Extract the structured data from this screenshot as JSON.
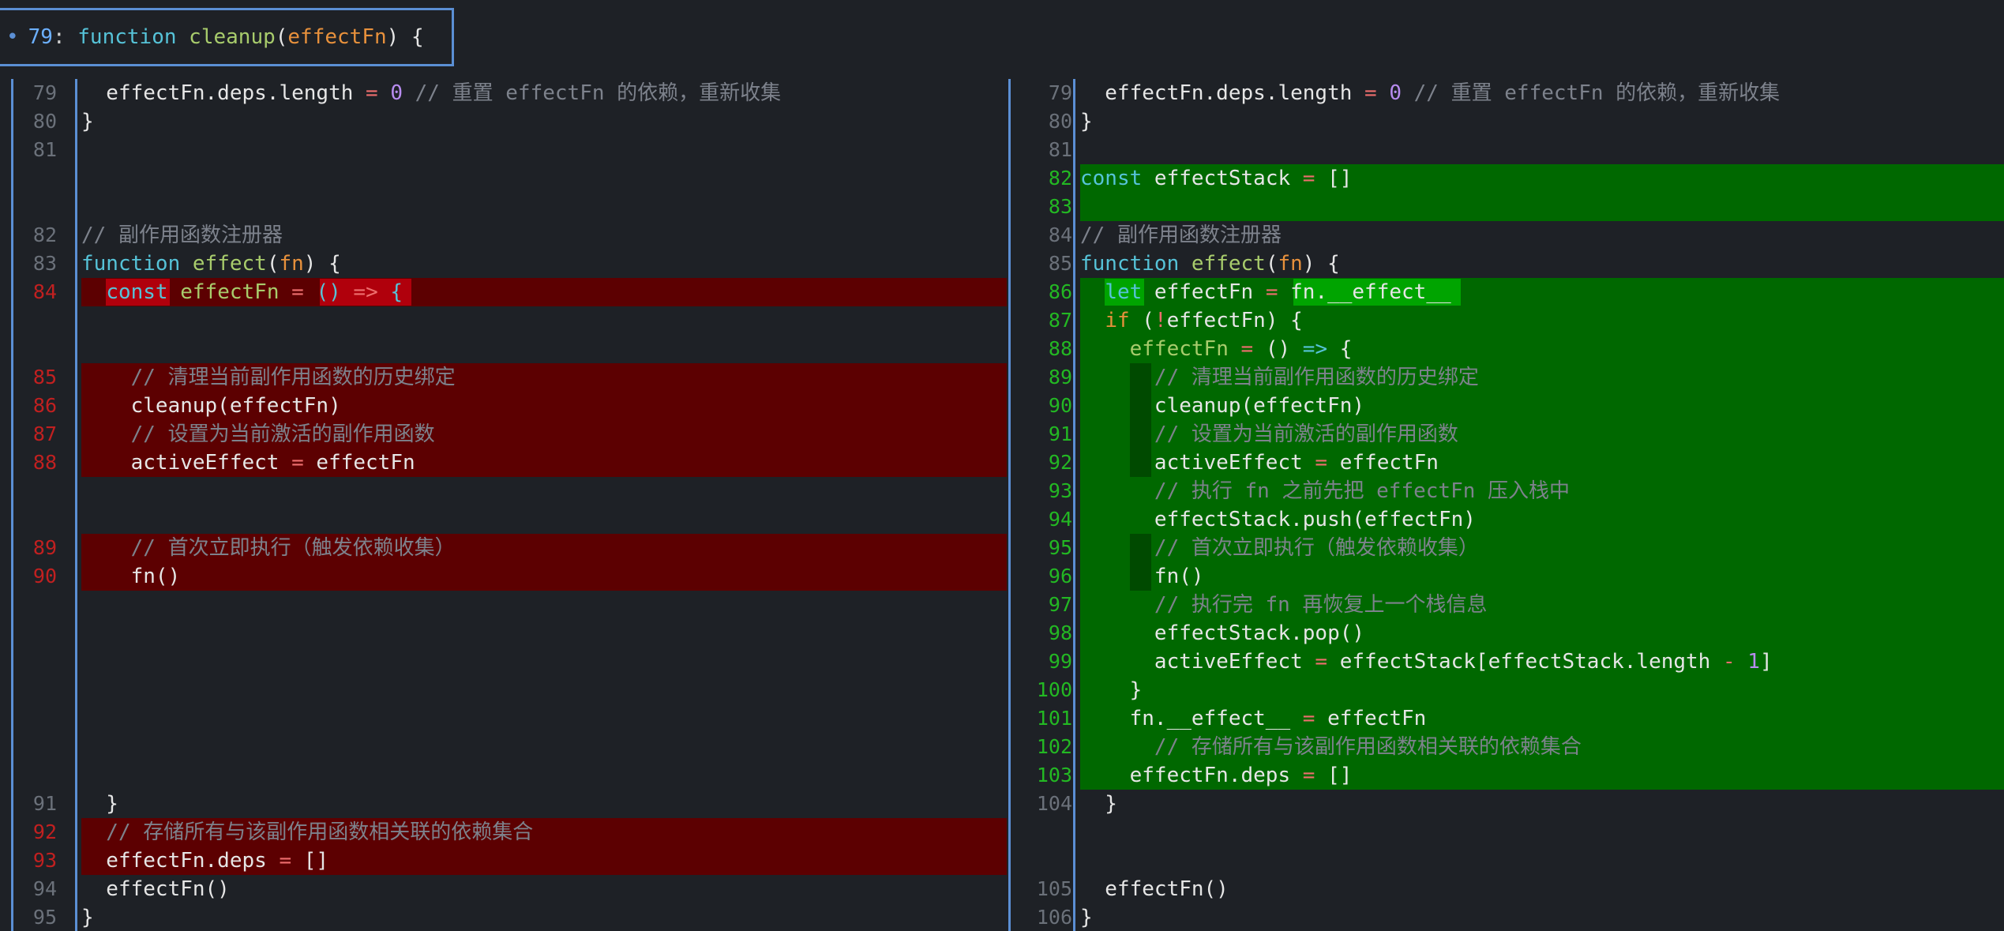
{
  "header": {
    "dot": "•",
    "line_number": "79",
    "colon": ":",
    "keyword": "function",
    "function_name": "cleanup",
    "open_paren": "(",
    "param": "effectFn",
    "close": ") {"
  },
  "left_pane": {
    "line_numbers": {
      "l79": "79",
      "l80": "80",
      "l81": "81",
      "l82": "82",
      "l83": "83",
      "l84": "84",
      "l85": "85",
      "l86": "86",
      "l87": "87",
      "l88": "88",
      "l89": "89",
      "l90": "90",
      "l91": "91",
      "l92": "92",
      "l93": "93",
      "l94": "94",
      "l95": "95"
    },
    "code": {
      "l79": "  effectFn.deps.length = 0 // 重置 effectFn 的依赖，重新收集",
      "l80": "}",
      "l82": "// 副作用函数注册器",
      "l83": "function effect(fn) {",
      "l84": "  const effectFn = () => {",
      "l85": "    // 清理当前副作用函数的历史绑定",
      "l86": "    cleanup(effectFn)",
      "l87": "    // 设置为当前激活的副作用函数",
      "l88": "    activeEffect = effectFn",
      "l89": "    // 首次立即执行（触发依赖收集）",
      "l90": "    fn()",
      "l91": "  }",
      "l92": "  // 存储所有与该副作用函数相关联的依赖集合",
      "l93": "  effectFn.deps = []",
      "l94": "  effectFn()",
      "l95": "}"
    }
  },
  "right_pane": {
    "line_numbers": {
      "l79": "79",
      "l80": "80",
      "l81": "81",
      "l82": "82",
      "l83": "83",
      "l84": "84",
      "l85": "85",
      "l86": "86",
      "l87": "87",
      "l88": "88",
      "l89": "89",
      "l90": "90",
      "l91": "91",
      "l92": "92",
      "l93": "93",
      "l94": "94",
      "l95": "95",
      "l96": "96",
      "l97": "97",
      "l98": "98",
      "l99": "99",
      "l100": "100",
      "l101": "101",
      "l102": "102",
      "l103": "103",
      "l104": "104",
      "l105": "105",
      "l106": "106"
    },
    "code": {
      "l79": "  effectFn.deps.length = 0 // 重置 effectFn 的依赖，重新收集",
      "l80": "}",
      "l82": "const effectStack = []",
      "l84": "// 副作用函数注册器",
      "l85": "function effect(fn) {",
      "l86": "  let effectFn = fn.__effect__",
      "l87": "  if (!effectFn) {",
      "l88": "    effectFn = () => {",
      "l89": "      // 清理当前副作用函数的历史绑定",
      "l90": "      cleanup(effectFn)",
      "l91": "      // 设置为当前激活的副作用函数",
      "l92": "      activeEffect = effectFn",
      "l93": "      // 执行 fn 之前先把 effectFn 压入栈中",
      "l94": "      effectStack.push(effectFn)",
      "l95": "      // 首次立即执行（触发依赖收集）",
      "l96": "      fn()",
      "l97": "      // 执行完 fn 再恢复上一个栈信息",
      "l98": "      effectStack.pop()",
      "l99": "      activeEffect = effectStack[effectStack.length - 1]",
      "l100": "    }",
      "l101": "    fn.__effect__ = effectFn",
      "l102": "      // 存储所有与该副作用函数相关联的依赖集合",
      "l103": "    effectFn.deps = []",
      "l104": "  }",
      "l105": "  effectFn()",
      "l106": "}"
    }
  },
  "colors": {
    "background": "#1e2126",
    "deleted_line": "#5c0001",
    "added_line": "#006800",
    "pane_border": "#5b8fd4"
  }
}
